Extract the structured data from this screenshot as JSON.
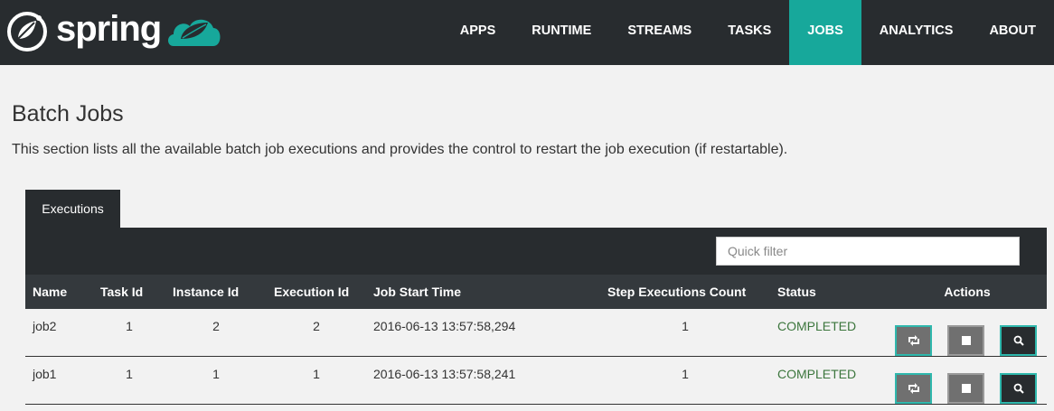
{
  "brand": {
    "name": "spring"
  },
  "nav": {
    "items": [
      "APPS",
      "RUNTIME",
      "STREAMS",
      "TASKS",
      "JOBS",
      "ANALYTICS",
      "ABOUT"
    ],
    "active": "JOBS",
    "active_color": "#17a89b"
  },
  "page": {
    "title": "Batch Jobs",
    "description": "This section lists all the available batch job executions and provides the control to restart the job execution (if restartable)."
  },
  "tab": {
    "label": "Executions"
  },
  "filter": {
    "placeholder": "Quick filter",
    "value": ""
  },
  "table": {
    "headers": [
      "Name",
      "Task Id",
      "Instance Id",
      "Execution Id",
      "Job Start Time",
      "Step Executions Count",
      "Status",
      "Actions"
    ],
    "rows": [
      {
        "name": "job2",
        "task_id": "1",
        "instance_id": "2",
        "execution_id": "2",
        "start_time": "2016-06-13 13:57:58,294",
        "step_count": "1",
        "status": "COMPLETED"
      },
      {
        "name": "job1",
        "task_id": "1",
        "instance_id": "1",
        "execution_id": "1",
        "start_time": "2016-06-13 13:57:58,241",
        "step_count": "1",
        "status": "COMPLETED"
      }
    ]
  },
  "actions": {
    "icons": [
      "restart-icon",
      "stop-icon",
      "search-icon"
    ]
  },
  "colors": {
    "header_bg": "#282c2f",
    "status_completed": "#3c763d",
    "accent": "#2fb8ad"
  }
}
